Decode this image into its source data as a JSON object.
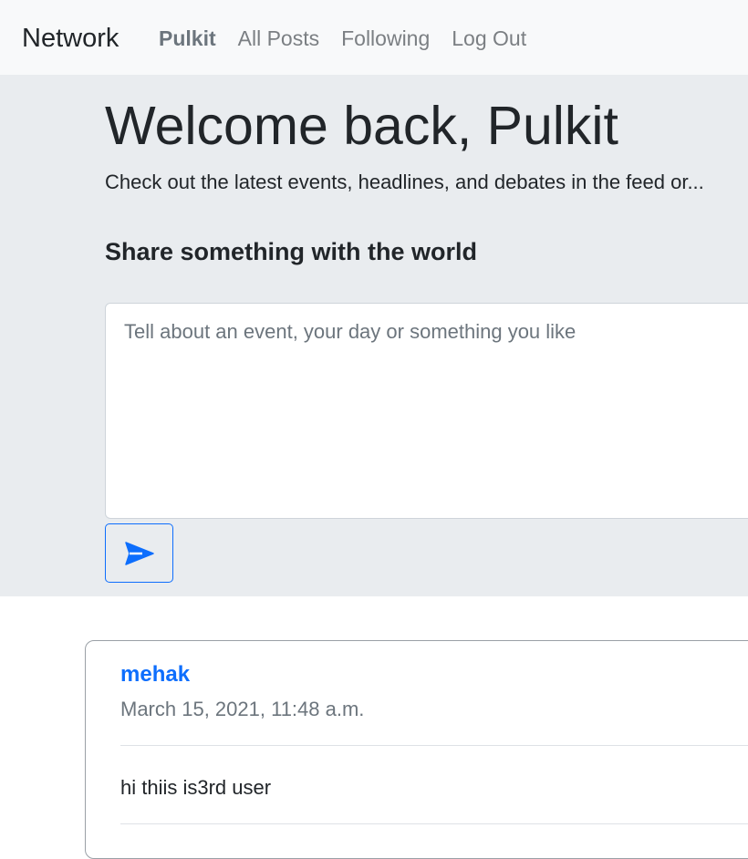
{
  "navbar": {
    "brand": "Network",
    "links": [
      {
        "label": "Pulkit",
        "active": true
      },
      {
        "label": "All Posts",
        "active": false
      },
      {
        "label": "Following",
        "active": false
      },
      {
        "label": "Log Out",
        "active": false
      }
    ]
  },
  "jumbotron": {
    "title": "Welcome back, Pulkit",
    "lead": "Check out the latest events, headlines, and debates in the feed or...",
    "share_heading": "Share something with the world",
    "textarea_placeholder": "Tell about an event, your day or something you like",
    "textarea_value": "",
    "send_icon": "send-icon",
    "accent_color": "#0d6efd"
  },
  "posts": [
    {
      "author": "mehak",
      "date": "March 15, 2021, 11:48 a.m.",
      "body": "hi thiis is3rd user"
    }
  ]
}
